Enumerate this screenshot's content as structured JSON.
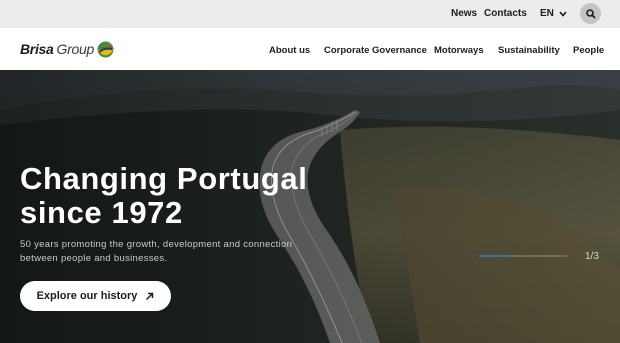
{
  "topbar": {
    "news": "News",
    "contacts": "Contacts",
    "language": "EN",
    "search_icon": "search-icon"
  },
  "brand": {
    "name_bold": "Brisa",
    "name_light": "Group"
  },
  "nav": {
    "items": [
      {
        "label": "About us"
      },
      {
        "label": "Corporate Governance"
      },
      {
        "label": "Motorways"
      },
      {
        "label": "Sustainability"
      },
      {
        "label": "People"
      }
    ]
  },
  "hero": {
    "title_line1": "Changing Portugal",
    "title_line2": "since 1972",
    "subtitle_line1": "50 years promoting the growth, development and connection",
    "subtitle_line2": "between people and businesses.",
    "cta_label": "Explore our history",
    "cta_icon": "arrow-up-right-icon",
    "slide_counter": "1/3",
    "slide_progress": 0.33
  },
  "colors": {
    "topbar_bg": "#ececec",
    "accent": "#3a6fb5",
    "logo_green": "#3f8f3a",
    "logo_yellow": "#f2b705"
  }
}
